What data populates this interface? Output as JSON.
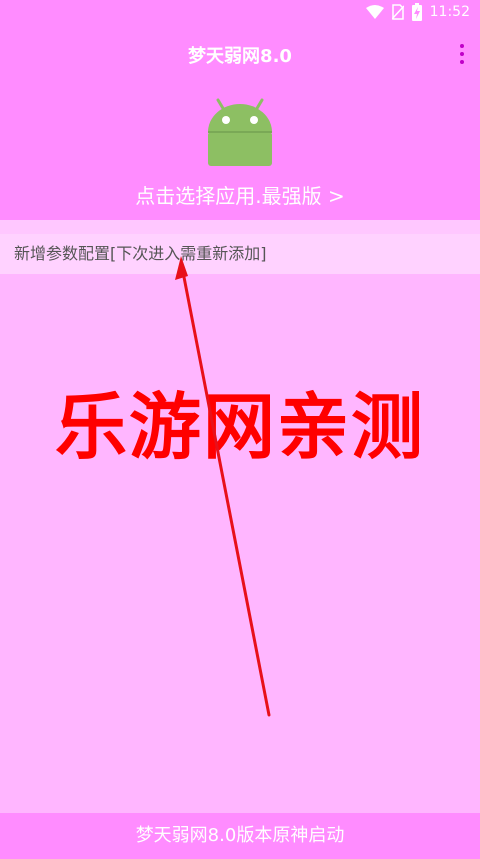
{
  "status_bar": {
    "time": "11:52"
  },
  "app_bar": {
    "title": "梦天弱网8.0"
  },
  "header": {
    "select_app_label": "点击选择应用.最强版 >"
  },
  "config": {
    "add_label": "新增参数配置[下次进入需重新添加]"
  },
  "overlay": {
    "watermark_text": "乐游网亲测"
  },
  "footer": {
    "launch_label": "梦天弱网8.0版本原神启动"
  },
  "colors": {
    "primary": "#ff8cff",
    "background": "#ffb6ff",
    "row": "#ffd2ff",
    "menu_dots": "#c000c8",
    "android_green": "#8dbf63",
    "watermark": "#ff0000"
  }
}
